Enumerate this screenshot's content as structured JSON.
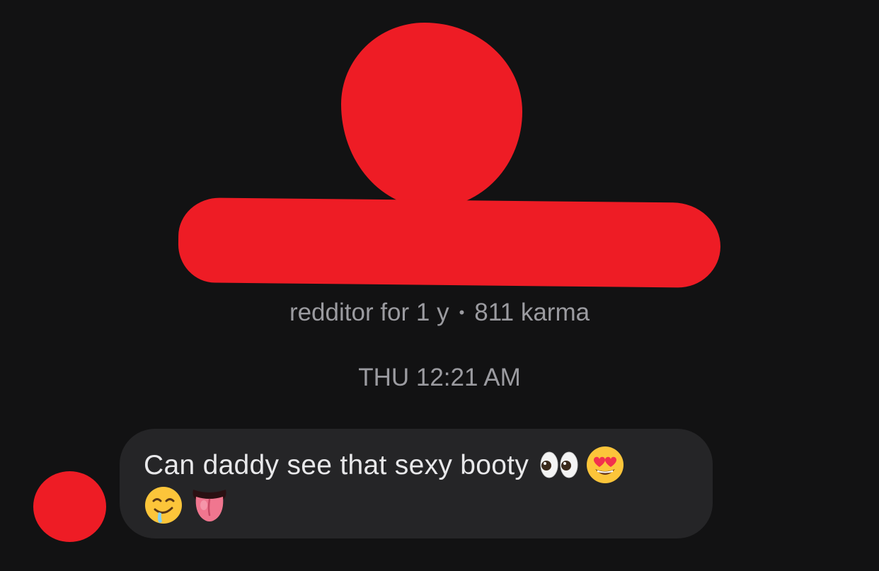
{
  "profile": {
    "redacted_color": "#ee1c25",
    "age_label": "redditor for 1 y",
    "separator": "•",
    "karma_label": "811 karma"
  },
  "thread": {
    "timestamp": "THU 12:21 AM"
  },
  "message": {
    "text": "Can daddy see that sexy booty",
    "emojis": [
      "eyes-emoji",
      "heart-eyes-emoji",
      "drooling-face-emoji",
      "tongue-emoji"
    ]
  },
  "colors": {
    "background": "#121213",
    "bubble": "#252527",
    "meta_text": "#9b9ba0",
    "message_text": "#e8e8ea"
  }
}
